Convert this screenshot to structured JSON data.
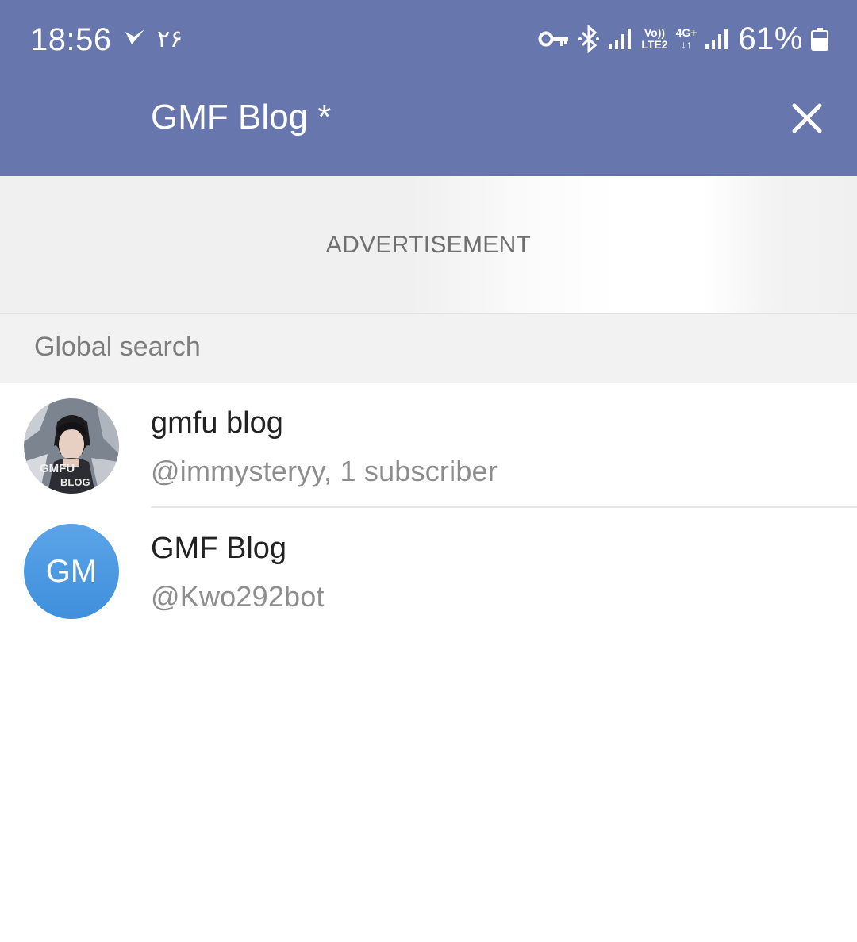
{
  "status_bar": {
    "time": "18:56",
    "date": "۲۶",
    "network_top": "Vo))",
    "network_bottom": "LTE2",
    "data_top": "4G+",
    "data_bottom": "↓↑",
    "battery": "61%"
  },
  "header": {
    "title": "GMF Blog *",
    "background_color": "#6777ad"
  },
  "advertisement": {
    "label": "ADVERTISEMENT"
  },
  "search": {
    "section_title": "Global search",
    "results": [
      {
        "title": "gmfu blog",
        "subtitle": "@immysteryy, 1 subscriber",
        "avatar_type": "photo",
        "avatar_photo_text": "GMFU BLOG"
      },
      {
        "title": "GMF Blog",
        "subtitle": "@Kwo292bot",
        "avatar_type": "initials",
        "avatar_initials": "GM",
        "avatar_color": "#4a96e0"
      }
    ]
  }
}
